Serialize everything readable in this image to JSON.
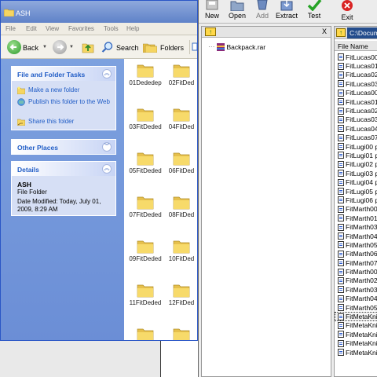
{
  "explorer": {
    "title": "ASH",
    "menu": [
      "File",
      "Edit",
      "View",
      "Favorites",
      "Tools",
      "Help"
    ],
    "toolbar": {
      "back_label": "Back",
      "search_label": "Search",
      "folders_label": "Folders"
    },
    "panels": {
      "file_folder_tasks": {
        "title": "File and Folder Tasks",
        "items": [
          "Make a new folder",
          "Publish this folder to the Web",
          "Share this folder"
        ]
      },
      "other_places": {
        "title": "Other Places"
      },
      "details": {
        "title": "Details",
        "name": "ASH",
        "type": "File Folder",
        "modified": "Date Modified: Today, July 01, 2009, 8:29 AM"
      }
    },
    "folders": [
      "01Dededep",
      "02FitDed",
      "03FitDeded",
      "04FitDed",
      "05FitDeded",
      "06FitDed",
      "07FitDeded",
      "08FitDed",
      "09FitDeded",
      "10FitDed",
      "11FitDeded",
      "12FitDed",
      "",
      ""
    ]
  },
  "archiver": {
    "toolbar": [
      "New",
      "Open",
      "Add",
      "Extract",
      "Test",
      "Exit"
    ],
    "tree": {
      "item": "Backpack.rar",
      "close_label": "X"
    },
    "path": "C:\\Docum",
    "column_header": "File Name",
    "files": [
      "FitLucas00",
      "FitLucas01",
      "FitLucas02",
      "FitLucas03",
      "FitLucas00.",
      "FitLucas01",
      "FitLucas02",
      "FitLucas03.",
      "FitLucas04.",
      "FitLucas07.",
      "FitLugi00 p",
      "FitLugi01 p",
      "FitLugi02 p",
      "FitLugi03 p",
      "FitLugi04 p",
      "FitLugi05 p",
      "FitLugi06 p",
      "FitMarth00",
      "FitMarth01",
      "FitMarth03",
      "FitMarth04",
      "FitMarth05",
      "FitMarth06",
      "FitMarth07",
      "FitMarth00.",
      "FitMarth02.",
      "FitMarth03.",
      "FitMarth04.",
      "FitMarth05.",
      "FitMetaKnig",
      "FitMetaKnig",
      "FitMetaKnig",
      "FitMetaKnig",
      "FitMetaKnig"
    ],
    "selected_index": 29
  },
  "colors": {
    "xp_titlebar": "#5f82c8",
    "task_pane": "#6b8ed6",
    "task_link": "#215dc6",
    "path_bg": "#234c8c",
    "folder_yellow": "#f5d562"
  }
}
